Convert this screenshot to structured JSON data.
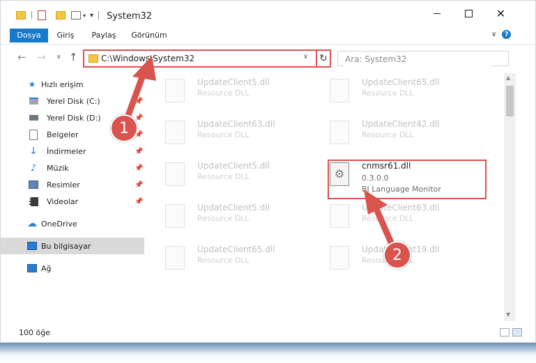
{
  "window": {
    "title": "System32"
  },
  "ribbon": {
    "tabs": [
      "Dosya",
      "Giriş",
      "Paylaş",
      "Görünüm"
    ]
  },
  "address": {
    "path": "C:\\Windows\\System32"
  },
  "search": {
    "placeholder": "Ara: System32"
  },
  "nav": {
    "items": [
      {
        "label": "Hızlı erişim",
        "icon": "quick-access-star-icon",
        "pinned": false
      },
      {
        "label": "Yerel Disk (C:)",
        "icon": "local-disk-icon",
        "pinned": true
      },
      {
        "label": "Yerel Disk (D:)",
        "icon": "local-disk-icon",
        "pinned": true
      },
      {
        "label": "Belgeler",
        "icon": "documents-icon",
        "pinned": true
      },
      {
        "label": "İndirmeler",
        "icon": "downloads-icon",
        "pinned": true
      },
      {
        "label": "Müzik",
        "icon": "music-icon",
        "pinned": true
      },
      {
        "label": "Resimler",
        "icon": "pictures-icon",
        "pinned": true
      },
      {
        "label": "Videolar",
        "icon": "videos-icon",
        "pinned": true
      },
      {
        "label": "OneDrive",
        "icon": "onedrive-icon",
        "pinned": false
      },
      {
        "label": "Bu bilgisayar",
        "icon": "this-pc-icon",
        "pinned": false
      },
      {
        "label": "Ağ",
        "icon": "network-icon",
        "pinned": false
      }
    ]
  },
  "files": [
    {
      "name": "UpdateClient5.dll",
      "desc": "Resource DLL"
    },
    {
      "name": "UpdateClient65.dll",
      "desc": "Resource DLL"
    },
    {
      "name": "UpdateClient63.dll",
      "desc": "Resource DLL"
    },
    {
      "name": "UpdateClient42.dll",
      "desc": "Resource DLL"
    },
    {
      "name": "UpdateClient5.dll",
      "desc": "Resource DLL"
    },
    {
      "name": "UpdateClient5.dll",
      "desc": "Resource DLL"
    },
    {
      "name": "UpdateClient63.dll",
      "desc": "Resource DLL"
    },
    {
      "name": "UpdateClient65.dll",
      "desc": "Resource DLL"
    },
    {
      "name": "UpdateClient19.dll",
      "desc": "Resource DLL"
    }
  ],
  "highlighted_file": {
    "name": "cnmsr61.dll",
    "version": "0.3.0.0",
    "desc": "BJ Language Monitor"
  },
  "status": {
    "count": "100 öğe"
  },
  "callouts": [
    "1",
    "2"
  ],
  "colors": {
    "accent": "#1979ca",
    "callout": "#d9534f"
  }
}
